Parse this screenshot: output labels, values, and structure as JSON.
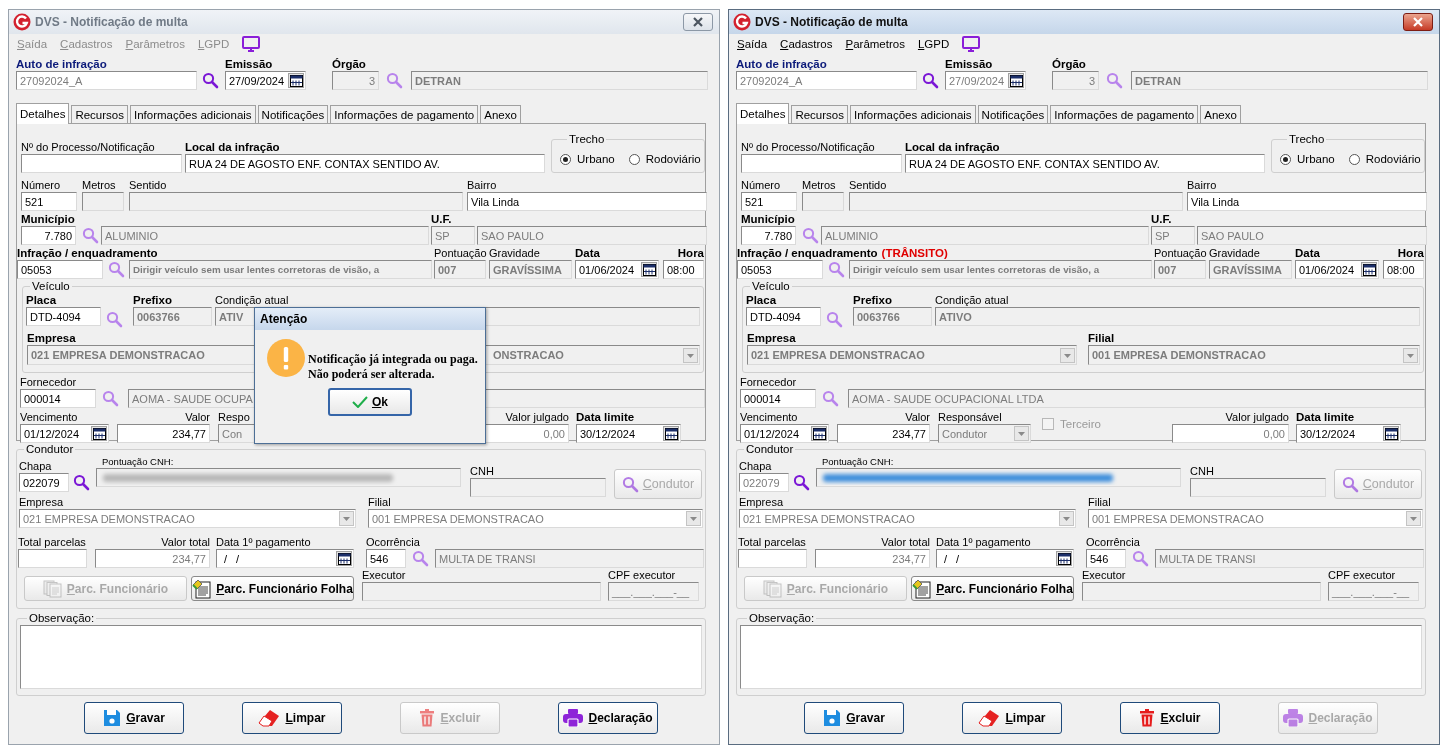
{
  "windows": [
    {
      "title": "DVS - Notificação de multa",
      "active": false,
      "menu": [
        {
          "label": "Saída",
          "disabled": true
        },
        {
          "label": "Cadastros",
          "disabled": true
        },
        {
          "label": "Parâmetros",
          "disabled": true
        },
        {
          "label": "LGPD",
          "disabled": true
        }
      ],
      "auto": {
        "label": "Auto de infração",
        "value": "27092024_A"
      },
      "emissao": {
        "label": "Emissão",
        "value": "27/09/2024",
        "readonly": false
      },
      "orgao": {
        "label": "Órgão",
        "code": "3",
        "name": "DETRAN"
      },
      "tabs": [
        {
          "label": "Detalhes",
          "selected": true
        },
        {
          "label": "Recursos",
          "selected": false
        },
        {
          "label": "Informações adicionais",
          "selected": false
        },
        {
          "label": "Notificações",
          "selected": false
        },
        {
          "label": "Informações de pagamento",
          "selected": false
        },
        {
          "label": "Anexo",
          "selected": false
        }
      ],
      "processo": {
        "label": "Nº do Processo/Notificação"
      },
      "local": {
        "label": "Local da infração",
        "value": "RUA 24 DE AGOSTO ENF. CONTAX SENTIDO AV."
      },
      "trecho": {
        "label": "Trecho",
        "options": [
          {
            "label": "Urbano",
            "selected": true
          },
          {
            "label": "Rodoviário",
            "selected": false
          }
        ]
      },
      "numero": {
        "label": "Número",
        "value": "521"
      },
      "metros": {
        "label": "Metros"
      },
      "sentido": {
        "label": "Sentido"
      },
      "bairro": {
        "label": "Bairro",
        "value": "Vila Linda"
      },
      "municipio": {
        "label": "Município",
        "code": "7.780",
        "name": "ALUMINIO"
      },
      "uf": {
        "label": "U.F.",
        "value": "SP",
        "name": "SAO PAULO"
      },
      "infracao": {
        "label": "Infração / enquadramento",
        "code": "05053",
        "description": "Dirigir veículo sem usar lentes corretoras de visão, a"
      },
      "pontuacao": {
        "label": "Pontuação",
        "value": "007"
      },
      "gravidade": {
        "label": "Gravidade",
        "value": "GRAVÍSSIMA"
      },
      "data": {
        "label": "Data",
        "value": "01/06/2024"
      },
      "hora": {
        "label": "Hora",
        "value": "08:00"
      },
      "veiculo": {
        "legend": "Veículo",
        "placa": {
          "label": "Placa",
          "value": "DTD-4094"
        },
        "prefixo": {
          "label": "Prefixo",
          "value": "0063766"
        },
        "condicao": {
          "label": "Condição atual",
          "value": "ATIV"
        },
        "empresa": {
          "label": "Empresa",
          "value": "021 EMPRESA DEMONSTRACAO"
        },
        "filial": {
          "value": "ONSTRACAO",
          "clipped": true
        }
      },
      "fornecedor": {
        "label": "Fornecedor",
        "code": "000014",
        "name": "AOMA - SAUDE OCUPA"
      },
      "vencimento": {
        "label": "Vencimento",
        "value": "01/12/2024"
      },
      "valor": {
        "label": "Valor",
        "value": "234,77"
      },
      "responsavel": {
        "label": "Respo",
        "value": "Con"
      },
      "valor_julgado": {
        "label": "Valor julgado",
        "value": "0,00"
      },
      "data_limite": {
        "label": "Data limite",
        "value": "30/12/2024"
      },
      "condutor": {
        "legend": "Condutor",
        "chapa": {
          "label": "Chapa",
          "value": "022079",
          "readonly": false
        },
        "pontuacao_cnh": {
          "label": "Pontuação CNH:",
          "color": "#b8b8b8"
        },
        "cnh": {
          "label": "CNH"
        },
        "button": {
          "label": "Condutor",
          "disabled": true
        },
        "empresa": {
          "label": "Empresa",
          "value": "021 EMPRESA DEMONSTRACAO"
        },
        "filial": {
          "label": "Filial",
          "value": "001 EMPRESA DEMONSTRACAO"
        },
        "total_parcelas": {
          "label": "Total parcelas"
        },
        "valor_total": {
          "label": "Valor total",
          "value": "234,77"
        },
        "data_pagamento": {
          "label": "Data 1º pagamento",
          "value": "/ /"
        },
        "ocorrencia": {
          "label": "Ocorrência",
          "code": "546",
          "name": "MULTA DE TRANSI"
        },
        "parcelas_buttons": [
          {
            "label": "Parc. Funcionário",
            "disabled": true,
            "kind": "copies"
          },
          {
            "label": "Parc. Funcionário Folha",
            "disabled": false,
            "kind": "sheet"
          }
        ],
        "executor": {
          "label": "Executor"
        },
        "cpf": {
          "label": "CPF executor",
          "value": "___.___.___-__"
        }
      },
      "observacao": {
        "legend": "Observação:"
      },
      "buttons": [
        {
          "label": "Gravar",
          "kind": "save",
          "disabled": false
        },
        {
          "label": "Limpar",
          "kind": "clear",
          "disabled": false
        },
        {
          "label": "Excluir",
          "kind": "delete",
          "disabled": true
        },
        {
          "label": "Declaração",
          "kind": "print",
          "disabled": false
        }
      ],
      "dialog": {
        "title": "Atenção",
        "message": [
          "Notificação já integrada ou paga.",
          "Não poderá ser alterada."
        ],
        "button": "Ok"
      }
    },
    {
      "title": "DVS - Notificação de multa",
      "active": true,
      "menu": [
        {
          "label": "Saída",
          "disabled": false
        },
        {
          "label": "Cadastros",
          "disabled": false
        },
        {
          "label": "Parâmetros",
          "disabled": false
        },
        {
          "label": "LGPD",
          "disabled": false
        }
      ],
      "auto": {
        "label": "Auto de infração",
        "value": "27092024_A"
      },
      "emissao": {
        "label": "Emissão",
        "value": "27/09/2024",
        "readonly": true
      },
      "orgao": {
        "label": "Órgão",
        "code": "3",
        "name": "DETRAN"
      },
      "tabs": [
        {
          "label": "Detalhes",
          "selected": true
        },
        {
          "label": "Recursos",
          "selected": false
        },
        {
          "label": "Informações adicionais",
          "selected": false
        },
        {
          "label": "Notificações",
          "selected": false
        },
        {
          "label": "Informações de pagamento",
          "selected": false
        },
        {
          "label": "Anexo",
          "selected": false
        }
      ],
      "processo": {
        "label": "Nº do Processo/Notificação"
      },
      "local": {
        "label": "Local da infração",
        "value": "RUA 24 DE AGOSTO ENF. CONTAX SENTIDO AV."
      },
      "trecho": {
        "label": "Trecho",
        "options": [
          {
            "label": "Urbano",
            "selected": true
          },
          {
            "label": "Rodoviário",
            "selected": false
          }
        ]
      },
      "numero": {
        "label": "Número",
        "value": "521"
      },
      "metros": {
        "label": "Metros"
      },
      "sentido": {
        "label": "Sentido"
      },
      "bairro": {
        "label": "Bairro",
        "value": "Vila Linda"
      },
      "municipio": {
        "label": "Município",
        "code": "7.780",
        "name": "ALUMINIO"
      },
      "uf": {
        "label": "U.F.",
        "value": "SP",
        "name": "SAO PAULO"
      },
      "infracao": {
        "label": "Infração / enquadramento",
        "tag": "(TRÂNSITO)",
        "code": "05053",
        "description": "Dirigir veículo sem usar lentes corretoras de visão, a"
      },
      "pontuacao": {
        "label": "Pontuação",
        "value": "007"
      },
      "gravidade": {
        "label": "Gravidade",
        "value": "GRAVÍSSIMA"
      },
      "data": {
        "label": "Data",
        "value": "01/06/2024"
      },
      "hora": {
        "label": "Hora",
        "value": "08:00"
      },
      "veiculo": {
        "legend": "Veículo",
        "placa": {
          "label": "Placa",
          "value": "DTD-4094"
        },
        "prefixo": {
          "label": "Prefixo",
          "value": "0063766"
        },
        "condicao": {
          "label": "Condição atual",
          "value": "ATIVO"
        },
        "empresa": {
          "label": "Empresa",
          "value": "021 EMPRESA DEMONSTRACAO"
        },
        "filial": {
          "label": "Filial",
          "value": "001 EMPRESA DEMONSTRACAO",
          "clipped": false
        }
      },
      "fornecedor": {
        "label": "Fornecedor",
        "code": "000014",
        "name": "AOMA - SAUDE OCUPACIONAL LTDA"
      },
      "vencimento": {
        "label": "Vencimento",
        "value": "01/12/2024"
      },
      "valor": {
        "label": "Valor",
        "value": "234,77"
      },
      "responsavel": {
        "label": "Responsável",
        "value": "Condutor"
      },
      "terceiro": {
        "label": "Terceiro",
        "checked": false
      },
      "valor_julgado": {
        "label": "Valor julgado",
        "value": "0,00"
      },
      "data_limite": {
        "label": "Data limite",
        "value": "30/12/2024"
      },
      "condutor": {
        "legend": "Condutor",
        "chapa": {
          "label": "Chapa",
          "value": "022079",
          "readonly": true
        },
        "pontuacao_cnh": {
          "label": "Pontuação CNH:",
          "color": "#3f8fdc"
        },
        "cnh": {
          "label": "CNH"
        },
        "button": {
          "label": "Condutor",
          "disabled": true
        },
        "empresa": {
          "label": "Empresa",
          "value": "021 EMPRESA DEMONSTRACAO"
        },
        "filial": {
          "label": "Filial",
          "value": "001 EMPRESA DEMONSTRACAO"
        },
        "total_parcelas": {
          "label": "Total parcelas"
        },
        "valor_total": {
          "label": "Valor total",
          "value": "234,77"
        },
        "data_pagamento": {
          "label": "Data 1º pagamento",
          "value": "/ /"
        },
        "ocorrencia": {
          "label": "Ocorrência",
          "code": "546",
          "name": "MULTA DE TRANSI"
        },
        "parcelas_buttons": [
          {
            "label": "Parc. Funcionário",
            "disabled": true,
            "kind": "copies"
          },
          {
            "label": "Parc. Funcionário Folha",
            "disabled": false,
            "kind": "sheet"
          }
        ],
        "executor": {
          "label": "Executor"
        },
        "cpf": {
          "label": "CPF executor",
          "value": "___.___.___-__"
        }
      },
      "observacao": {
        "legend": "Observação:"
      },
      "buttons": [
        {
          "label": "Gravar",
          "kind": "save",
          "disabled": false
        },
        {
          "label": "Limpar",
          "kind": "clear",
          "disabled": false
        },
        {
          "label": "Excluir",
          "kind": "delete",
          "disabled": false
        },
        {
          "label": "Declaração",
          "kind": "print",
          "disabled": true
        }
      ]
    }
  ]
}
